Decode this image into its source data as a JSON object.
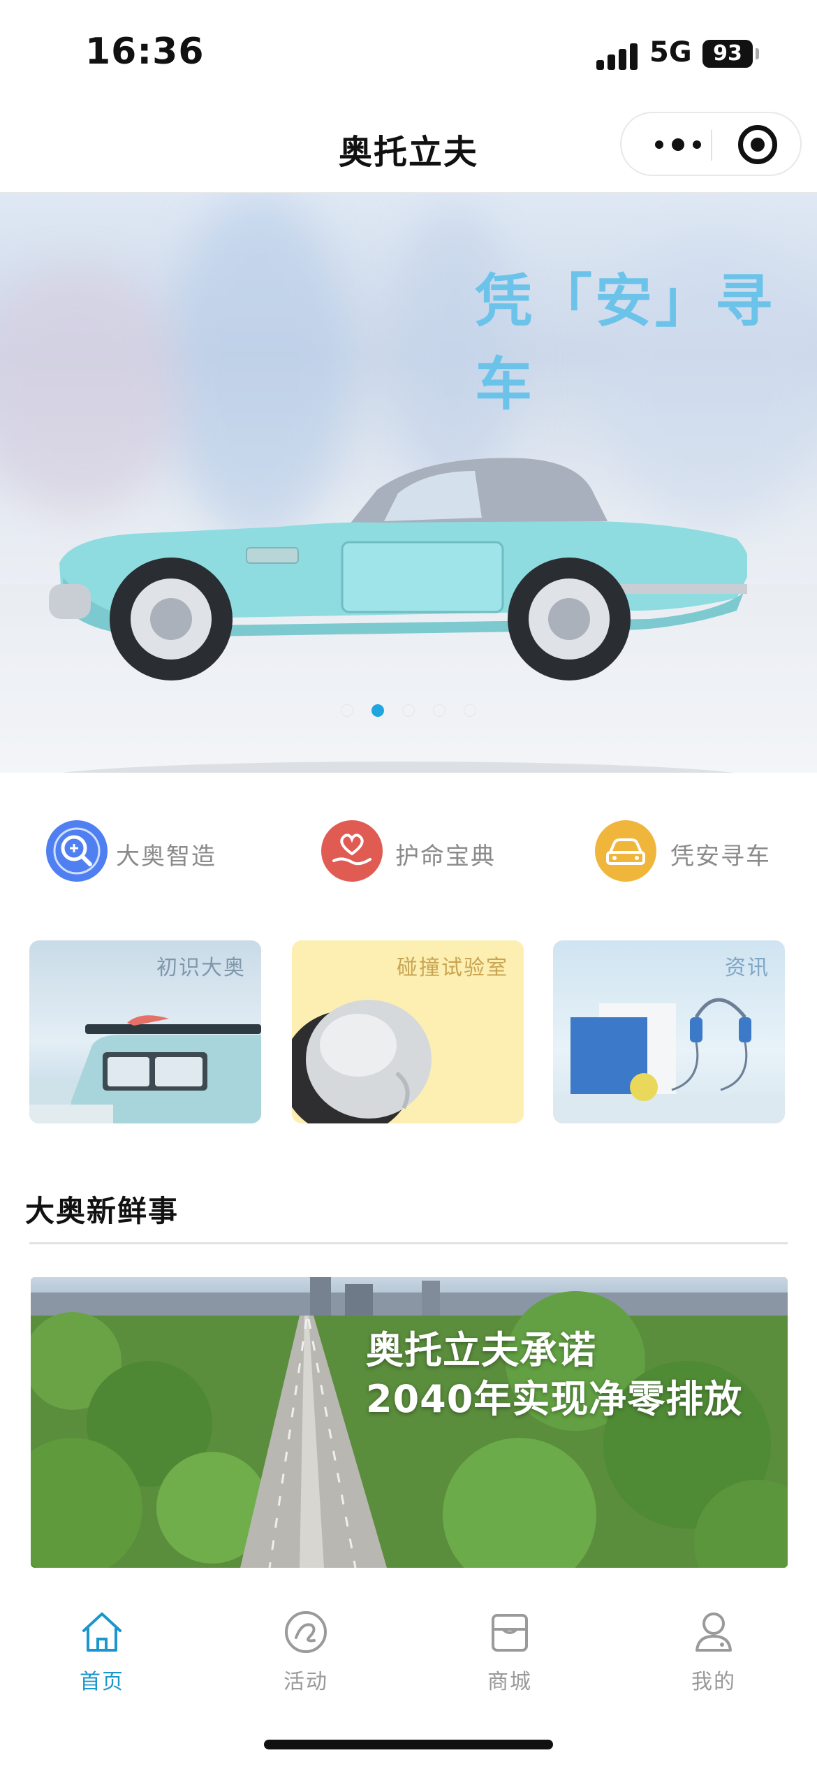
{
  "status_bar": {
    "time": "16:36",
    "network": "5G",
    "battery": "93"
  },
  "nav": {
    "title": "奥托立夫"
  },
  "banner": {
    "heading": "凭「安」寻车",
    "total_slides": 5,
    "active_slide": 2
  },
  "quick_links": [
    {
      "label": "大奥智造",
      "icon": "search-gear-icon",
      "color": "#4f7ff0"
    },
    {
      "label": "护命宝典",
      "icon": "heart-hand-icon",
      "color": "#e05b52"
    },
    {
      "label": "凭安寻车",
      "icon": "car-icon",
      "color": "#f0b63c"
    }
  ],
  "cards": [
    {
      "title": "初识大奥",
      "title_color": "#7f97ab"
    },
    {
      "title": "碰撞试验室",
      "title_color": "#c9a453"
    },
    {
      "title": "资讯",
      "title_color": "#7fa6c4"
    }
  ],
  "news": {
    "section_title": "大奥新鲜事",
    "line1": "奥托立夫承诺",
    "line2": "2040年实现净零排放"
  },
  "tabs": [
    {
      "label": "首页",
      "icon": "home-icon",
      "active": true
    },
    {
      "label": "活动",
      "icon": "activity-icon",
      "active": false
    },
    {
      "label": "商城",
      "icon": "store-icon",
      "active": false
    },
    {
      "label": "我的",
      "icon": "profile-icon",
      "active": false
    }
  ],
  "colors": {
    "accent": "#1b96cc",
    "dot_active": "#1fa6e0"
  }
}
